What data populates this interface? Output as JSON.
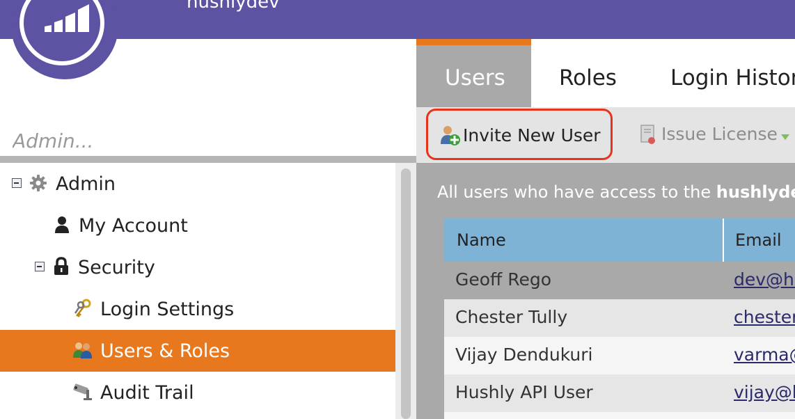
{
  "header": {
    "subdomain": "hushlydev",
    "brand_color": "#5c53a3",
    "logo_icon": "marketo-logo-icon"
  },
  "sidebar": {
    "search_placeholder": "Admin...",
    "tree": [
      {
        "label": "Admin",
        "icon": "gear-icon",
        "expanded": true
      },
      {
        "label": "My Account",
        "icon": "person-icon"
      },
      {
        "label": "Security",
        "icon": "lock-icon",
        "expanded": true
      },
      {
        "label": "Login Settings",
        "icon": "keys-icon"
      },
      {
        "label": "Users & Roles",
        "icon": "users-icon",
        "selected": true
      },
      {
        "label": "Audit Trail",
        "icon": "camera-icon"
      }
    ]
  },
  "tabs": [
    {
      "label": "Users",
      "active": true
    },
    {
      "label": "Roles"
    },
    {
      "label": "Login Histor"
    }
  ],
  "toolbar": {
    "invite_label": "Invite New User",
    "issue_label": "Issue License"
  },
  "description": {
    "prefix": "All users who have access to the ",
    "bold": "hushlyde"
  },
  "table": {
    "columns": [
      "Name",
      "Email"
    ],
    "rows": [
      {
        "name": "Geoff Rego",
        "email": "dev@hu"
      },
      {
        "name": "Chester Tully",
        "email": "chester"
      },
      {
        "name": "Vijay Dendukuri",
        "email": "varma@"
      },
      {
        "name": "Hushly API User",
        "email": "vijay@le"
      }
    ]
  },
  "colors": {
    "accent_orange": "#e8781e",
    "highlight_red": "#e8331c",
    "table_header": "#7fb3d5"
  }
}
